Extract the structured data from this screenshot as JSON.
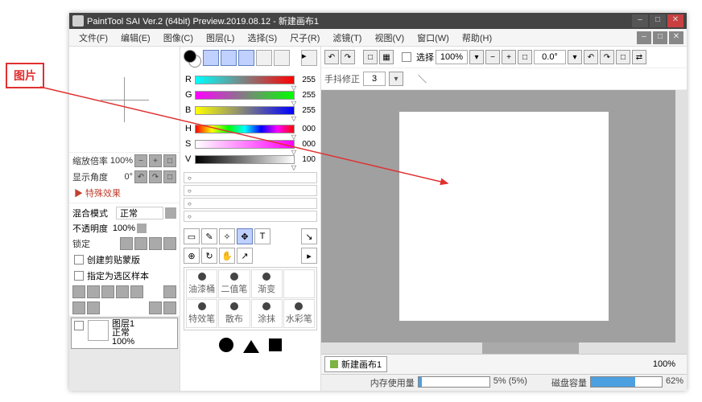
{
  "annotation": {
    "label": "图片"
  },
  "titlebar": {
    "title": "PaintTool SAI Ver.2 (64bit) Preview.2019.08.12 - 新建画布1"
  },
  "menu": {
    "file": "文件(F)",
    "edit": "编辑(E)",
    "image": "图像(C)",
    "layer": "图层(L)",
    "select": "选择(S)",
    "ruler": "尺子(R)",
    "filter": "滤镜(T)",
    "view": "视图(V)",
    "window": "窗口(W)",
    "help": "帮助(H)"
  },
  "nav": {
    "zoom_label": "缩放倍率",
    "zoom_value": "100%",
    "angle_label": "显示角度",
    "angle_value": "0°"
  },
  "effects": {
    "title": "▶ 特殊效果"
  },
  "blend": {
    "label": "混合模式",
    "value": "正常"
  },
  "opacity": {
    "label": "不透明度",
    "value": "100%"
  },
  "lock": {
    "label": "锁定"
  },
  "clip_mask": {
    "label": "创建剪贴蒙版"
  },
  "sel_sample": {
    "label": "指定为选区样本"
  },
  "layer": {
    "name": "图层1",
    "mode": "正常",
    "opacity": "100%"
  },
  "rgb": {
    "r": "R",
    "g": "G",
    "b": "B",
    "h": "H",
    "s": "S",
    "v": "V",
    "r_val": "255",
    "g_val": "255",
    "b_val": "255",
    "h_val": "000",
    "s_val": "000",
    "v_val": "100"
  },
  "brushes": {
    "b1": "油漆桶",
    "b2": "二值笔",
    "b3": "渐变",
    "b4": "",
    "b5": "特效笔",
    "b6": "散布",
    "b7": "涂抹",
    "b8": "水彩笔"
  },
  "toolbar": {
    "select_label": "选择",
    "zoom": "100%",
    "angle": "0.0°"
  },
  "stabilizer": {
    "label": "手抖修正",
    "value": "3"
  },
  "doc_tab": {
    "name": "新建画布1",
    "zoom": "100%"
  },
  "status": {
    "mem_label": "内存使用量",
    "mem_text": "5% (5%)",
    "disk_label": "磁盘容量",
    "disk_text": "62%"
  }
}
